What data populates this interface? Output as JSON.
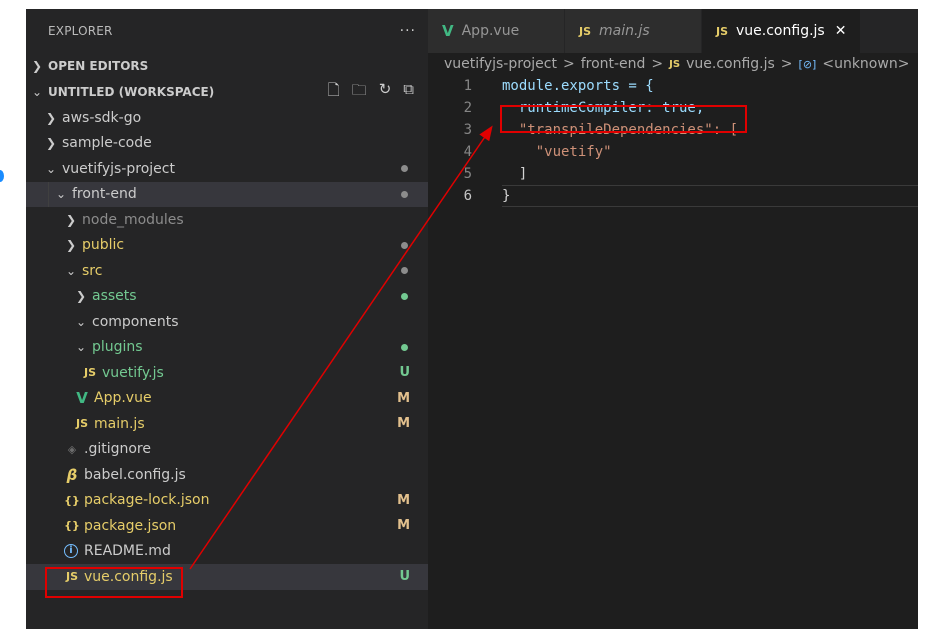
{
  "explorer": {
    "title": "EXPLORER",
    "more_label": "···",
    "open_editors": "OPEN EDITORS",
    "workspace": "UNTITLED (WORKSPACE)",
    "items": [
      {
        "label": "aws-sdk-go",
        "type": "folder",
        "expanded": false
      },
      {
        "label": "sample-code",
        "type": "folder",
        "expanded": false
      },
      {
        "label": "vuetifyjs-project",
        "type": "folder",
        "expanded": true
      },
      {
        "label": "front-end",
        "type": "folder",
        "expanded": true
      },
      {
        "label": "node_modules",
        "type": "folder",
        "expanded": false
      },
      {
        "label": "public",
        "type": "folder",
        "expanded": false
      },
      {
        "label": "src",
        "type": "folder",
        "expanded": true
      },
      {
        "label": "assets",
        "type": "folder",
        "expanded": false
      },
      {
        "label": "components",
        "type": "folder",
        "expanded": true
      },
      {
        "label": "plugins",
        "type": "folder",
        "expanded": true
      },
      {
        "label": "vuetify.js",
        "type": "js",
        "status": "U"
      },
      {
        "label": "App.vue",
        "type": "vue",
        "status": "M"
      },
      {
        "label": "main.js",
        "type": "js",
        "status": "M"
      },
      {
        "label": ".gitignore",
        "type": "git"
      },
      {
        "label": "babel.config.js",
        "type": "babel"
      },
      {
        "label": "package-lock.json",
        "type": "json",
        "status": "M"
      },
      {
        "label": "package.json",
        "type": "json",
        "status": "M"
      },
      {
        "label": "README.md",
        "type": "info"
      },
      {
        "label": "vue.config.js",
        "type": "js",
        "status": "U"
      }
    ]
  },
  "icons": {
    "js": "JS",
    "json": "{}",
    "vue": "V",
    "info": "i",
    "babel": "β",
    "git": "◈"
  },
  "tabs": [
    {
      "label": "App.vue",
      "icon": "vue"
    },
    {
      "label": "main.js",
      "icon": "js"
    },
    {
      "label": "vue.config.js",
      "icon": "js",
      "active": true
    }
  ],
  "close_glyph": "✕",
  "breadcrumb": {
    "project": "vuetifyjs-project",
    "folder": "front-end",
    "file": "vue.config.js",
    "symbol_icon": "[⊘]",
    "symbol": "<unknown>",
    "sep": ">"
  },
  "code_lines": [
    "module.exports = {",
    "  runtimeCompiler: true,",
    "  \"transpileDependencies\": [",
    "    \"vuetify\"",
    "  ]",
    "}"
  ],
  "colors": {
    "annotation": "#e00000",
    "modified": "#e2c08d",
    "untracked": "#73c991"
  }
}
